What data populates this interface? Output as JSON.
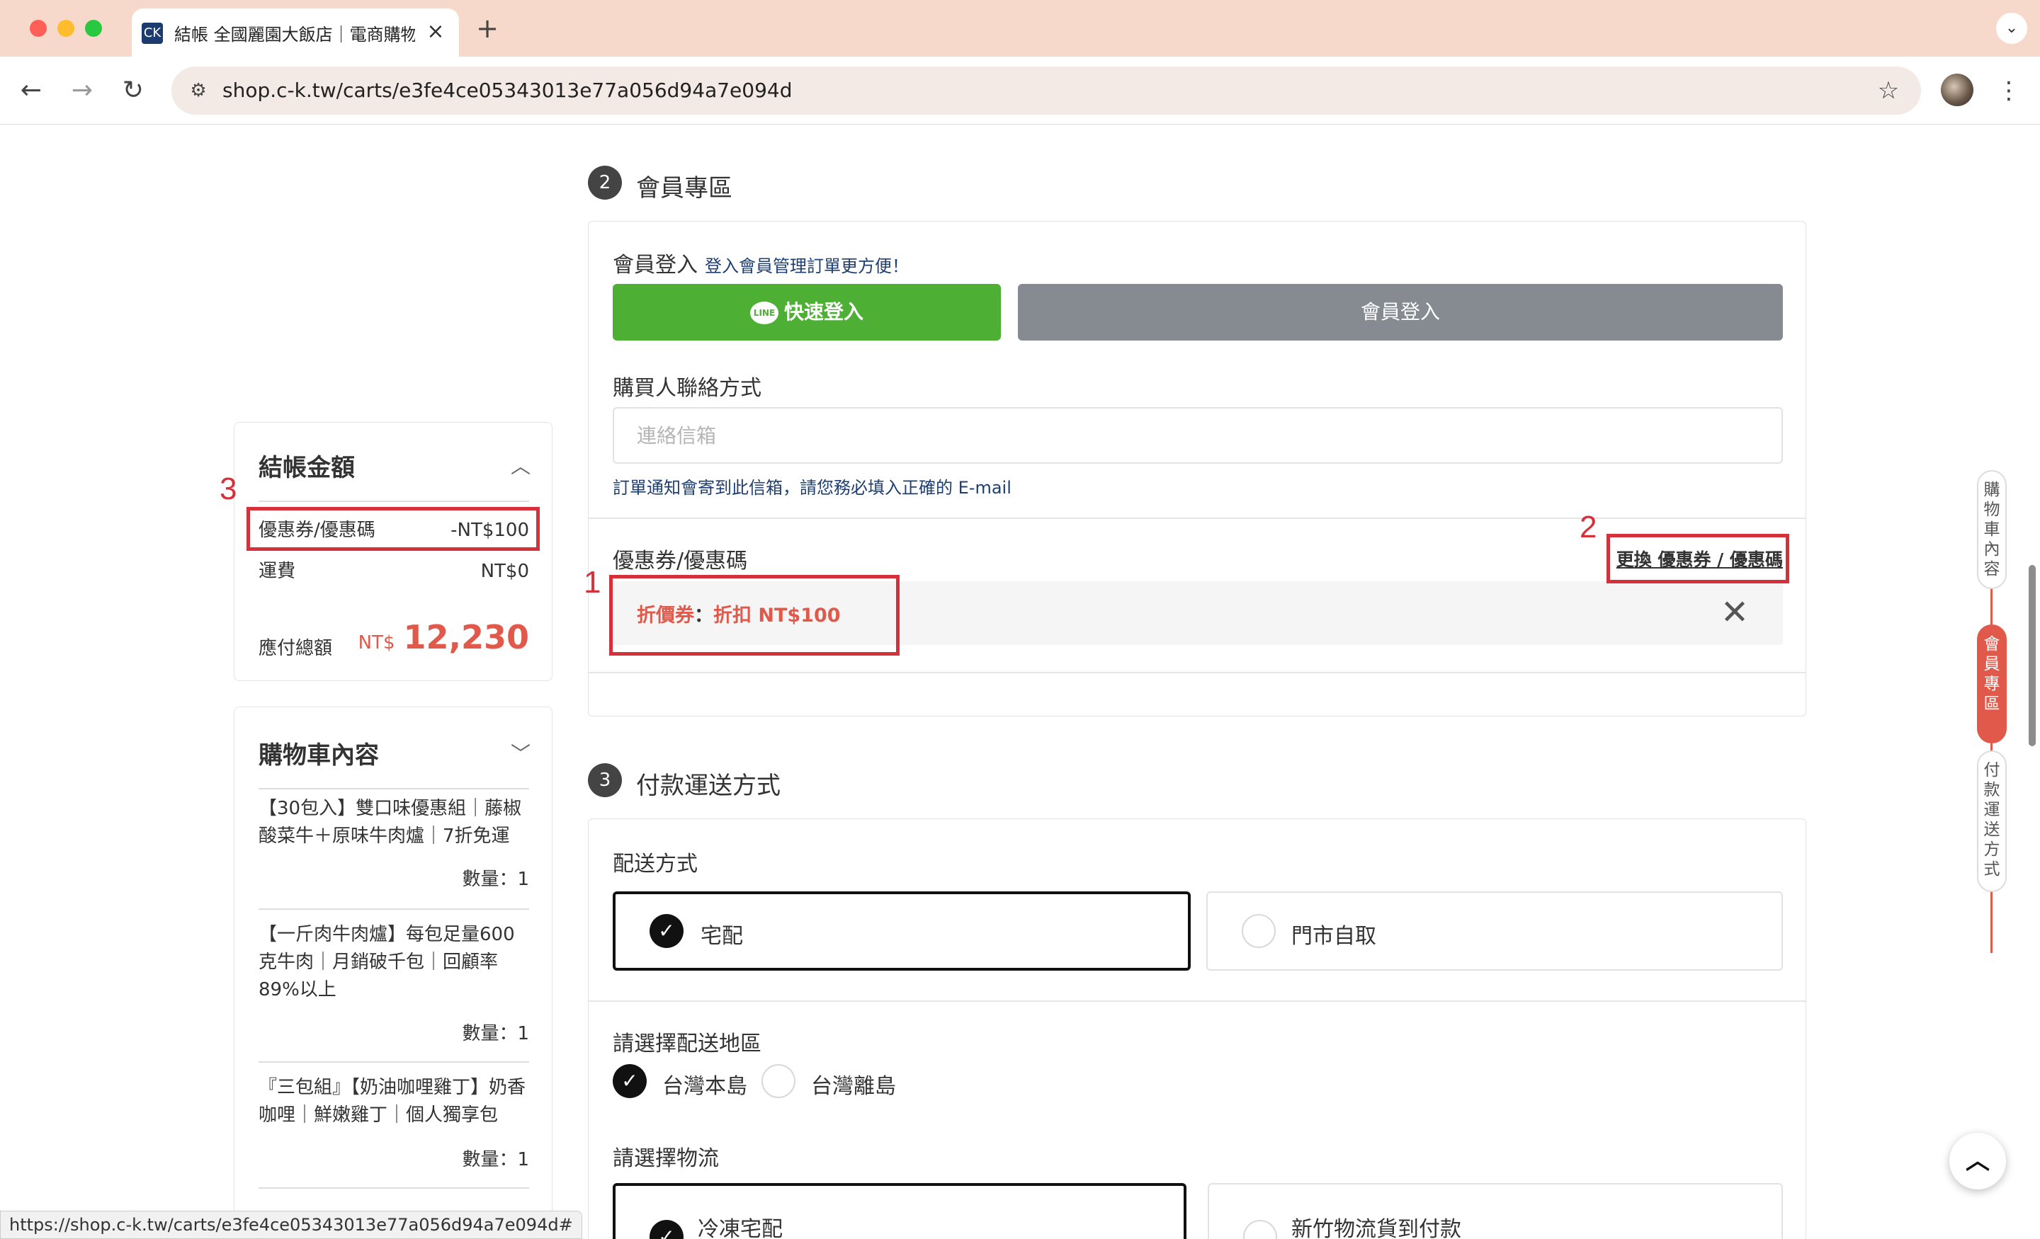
{
  "browser": {
    "tab_title": "結帳 全國麗園大飯店｜電商購物",
    "tab_favicon": "CK",
    "url": "shop.c-k.tw/carts/e3fe4ce05343013e77a056d94a7e094d",
    "status_url": "https://shop.c-k.tw/carts/e3fe4ce05343013e77a056d94a7e094d#"
  },
  "summary": {
    "title": "結帳金額",
    "discount_label": "優惠券/優惠碼",
    "discount_value": "-NT$100",
    "shipping_label": "運費",
    "shipping_value": "NT$0",
    "total_label": "應付總額",
    "total_currency": "NT$",
    "total_amount": "12,230"
  },
  "cart": {
    "title": "購物車內容",
    "items": [
      {
        "name": "【30包入】雙口味優惠組｜藤椒酸菜牛＋原味牛肉爐｜7折免運",
        "qty": "數量：1"
      },
      {
        "name": "【一斤肉牛肉爐】每包足量600克牛肉｜月銷破千包｜回顧率89%以上",
        "qty": "數量：1"
      },
      {
        "name": "『三包組』【奶油咖哩雞丁】奶香咖哩｜鮮嫩雞丁｜個人獨享包",
        "qty": "數量：1"
      }
    ]
  },
  "member": {
    "section_num": "2",
    "section_title": "會員專區",
    "login_label": "會員登入",
    "login_hint": "登入會員管理訂單更方便！",
    "line_button": "快速登入",
    "member_button": "會員登入",
    "contact_label": "購買人聯絡方式",
    "email_placeholder": "連絡信箱",
    "email_note": "訂單通知會寄到此信箱，請您務必填入正確的 E-mail",
    "coupon_label": "優惠券/優惠碼",
    "coupon_change": "更換 優惠券 / 優惠碼",
    "coupon_type": "折價券",
    "coupon_sep": "：",
    "coupon_value": "折扣 NT$100"
  },
  "payment": {
    "section_num": "3",
    "section_title": "付款運送方式",
    "delivery_label": "配送方式",
    "delivery_options": [
      "宅配",
      "門市自取"
    ],
    "region_label": "請選擇配送地區",
    "region_options": [
      "台灣本島",
      "台灣離島"
    ],
    "logistics_label": "請選擇物流",
    "logistics_options": [
      "冷凍宅配",
      "新竹物流貨到付款"
    ]
  },
  "annotations": [
    "1",
    "2",
    "3"
  ],
  "stepper": [
    "購物車內容",
    "會員專區",
    "付款運送方式"
  ],
  "colors": {
    "accent": "#e0594a",
    "line_green": "#4db035",
    "annotation": "#d6313a"
  }
}
